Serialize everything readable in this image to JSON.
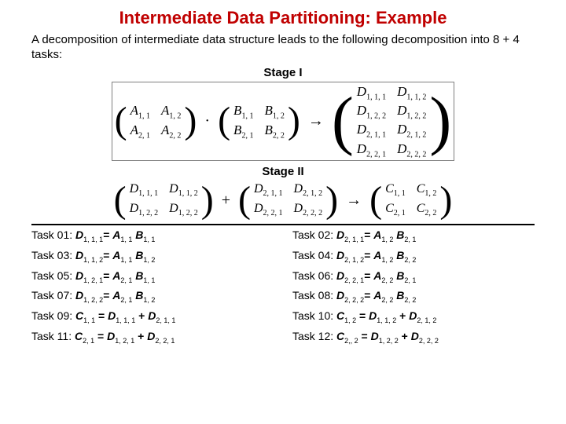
{
  "title": "Intermediate Data Partitioning: Example",
  "intro": "A decomposition of intermediate data structure   leads to the following decomposition into 8 + 4 tasks:",
  "stage1_label": "Stage I",
  "stage2_label": "Stage II",
  "eq1": {
    "A": [
      [
        "A",
        "1, 1"
      ],
      [
        "A",
        "1, 2"
      ],
      [
        "A",
        "2, 1"
      ],
      [
        "A",
        "2, 2"
      ]
    ],
    "dot": "·",
    "B": [
      [
        "B",
        "1, 1"
      ],
      [
        "B",
        "1, 2"
      ],
      [
        "B",
        "2, 1"
      ],
      [
        "B",
        "2, 2"
      ]
    ],
    "arrow": "→",
    "D": [
      [
        "D",
        "1, 1, 1"
      ],
      [
        "D",
        "1, 1, 2"
      ],
      [
        "D",
        "1, 2, 2"
      ],
      [
        "D",
        "1, 2, 2"
      ],
      [
        "D",
        "2, 1, 1"
      ],
      [
        "D",
        "2, 1, 2"
      ],
      [
        "D",
        "2, 2, 1"
      ],
      [
        "D",
        "2, 2, 2"
      ]
    ]
  },
  "eq2": {
    "M1": [
      [
        "D",
        "1, 1, 1"
      ],
      [
        "D",
        "1, 1, 2"
      ],
      [
        "D",
        "1, 2, 2"
      ],
      [
        "D",
        "1, 2, 2"
      ]
    ],
    "plus": "+",
    "M2": [
      [
        "D",
        "2, 1, 1"
      ],
      [
        "D",
        "2, 1, 2"
      ],
      [
        "D",
        "2, 2, 1"
      ],
      [
        "D",
        "2, 2, 2"
      ]
    ],
    "arrow": "→",
    "C": [
      [
        "C",
        "1, 1"
      ],
      [
        "C",
        "1, 2"
      ],
      [
        "C",
        "2, 1"
      ],
      [
        "C",
        "2, 2"
      ]
    ]
  },
  "tasks": [
    {
      "label": "Task 01:  ",
      "lhsV": "D",
      "lhsS": "1, 1, 1",
      "op": "= ",
      "aV": "A",
      "aS": "1, 1",
      "mid": " ",
      "bV": "B",
      "bS": "1, 1"
    },
    {
      "label": "Task 02:  ",
      "lhsV": "D",
      "lhsS": "2, 1, 1",
      "op": "= ",
      "aV": "A",
      "aS": "1, 2",
      "mid": " ",
      "bV": "B",
      "bS": "2, 1"
    },
    {
      "label": "Task 03:  ",
      "lhsV": "D",
      "lhsS": "1, 1, 2",
      "op": "= ",
      "aV": "A",
      "aS": "1, 1",
      "mid": " ",
      "bV": "B",
      "bS": "1, 2"
    },
    {
      "label": "Task 04:  ",
      "lhsV": "D",
      "lhsS": "2, 1, 2",
      "op": "= ",
      "aV": "A",
      "aS": "1, 2",
      "mid": " ",
      "bV": "B",
      "bS": "2, 2"
    },
    {
      "label": "Task 05:  ",
      "lhsV": "D",
      "lhsS": "1, 2, 1",
      "op": "= ",
      "aV": "A",
      "aS": "2, 1",
      "mid": " ",
      "bV": "B",
      "bS": "1, 1"
    },
    {
      "label": "Task 06:  ",
      "lhsV": "D",
      "lhsS": "2, 2, 1",
      "op": "= ",
      "aV": "A",
      "aS": "2, 2",
      "mid": " ",
      "bV": "B",
      "bS": "2, 1"
    },
    {
      "label": "Task 07:  ",
      "lhsV": "D",
      "lhsS": "1, 2, 2",
      "op": "= ",
      "aV": "A",
      "aS": "2, 1",
      "mid": " ",
      "bV": "B",
      "bS": "1, 2"
    },
    {
      "label": "Task 08:  ",
      "lhsV": "D",
      "lhsS": "2, 2, 2",
      "op": "= ",
      "aV": "A",
      "aS": "2, 2",
      "mid": " ",
      "bV": "B",
      "bS": "2, 2"
    },
    {
      "label": "Task 09:  ",
      "lhsV": "C",
      "lhsS": "1, 1",
      "op": " = ",
      "aV": "D",
      "aS": "1, 1, 1",
      "mid": " + ",
      "bV": "D",
      "bS": "2, 1, 1"
    },
    {
      "label": "Task 10:  ",
      "lhsV": "C",
      "lhsS": "1, 2",
      "op": " = ",
      "aV": "D",
      "aS": "1, 1, 2",
      "mid": " + ",
      "bV": "D",
      "bS": "2, 1, 2"
    },
    {
      "label": "Task 11:  ",
      "lhsV": "C",
      "lhsS": "2, 1",
      "op": " = ",
      "aV": "D",
      "aS": "1, 2, 1",
      "mid": " + ",
      "bV": "D",
      "bS": "2, 2, 1"
    },
    {
      "label": "Task 12:  ",
      "lhsV": "C",
      "lhsS": "2,, 2",
      "op": " = ",
      "aV": "D",
      "aS": "1, 2, 2",
      "mid": " + ",
      "bV": "D",
      "bS": "2, 2, 2"
    }
  ]
}
